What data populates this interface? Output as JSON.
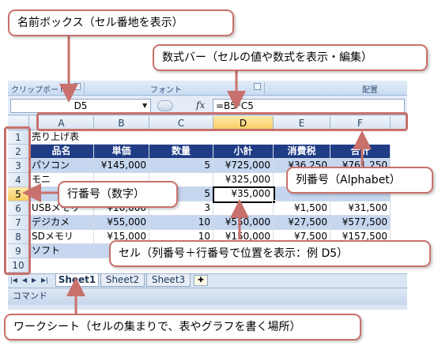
{
  "callouts": {
    "namebox": "名前ボックス（セル番地を表示）",
    "formulabar": "数式バー（セルの値や数式を表示・編集）",
    "column_number": "列番号（Alphabet）",
    "row_number": "行番号（数字）",
    "cell": "セル（列番号＋行番号で位置を表示：例 D5）",
    "worksheet": "ワークシート（セルの集まりで、表やグラフを書く場所）"
  },
  "ribbon": {
    "groups": [
      "クリップボード",
      "フォント",
      "配置"
    ]
  },
  "formula_bar": {
    "namebox_value": "D5",
    "fx_label": "fx",
    "formula": "=B5*C5"
  },
  "grid": {
    "columns": [
      "A",
      "B",
      "C",
      "D",
      "E",
      "F"
    ],
    "rows": [
      "1",
      "2",
      "3",
      "4",
      "5",
      "6",
      "7",
      "8",
      "9",
      "10"
    ],
    "selected_column": "D",
    "selected_row": "5",
    "title": "売り上げ表",
    "headers": [
      "品名",
      "単価",
      "数量",
      "小計",
      "消費税",
      "合計"
    ],
    "data": [
      [
        "パソコン",
        "¥145,000",
        "5",
        "¥725,000",
        "¥36,250",
        "¥761,250"
      ],
      [
        "モニ",
        "",
        "",
        "¥325,000",
        "",
        ""
      ],
      [
        "",
        "",
        "5",
        "¥35,000",
        "",
        ""
      ],
      [
        "USBメモリ",
        "¥10,000",
        "3",
        "",
        "¥1,500",
        "¥31,500"
      ],
      [
        "デジカメ",
        "¥55,000",
        "10",
        "¥550,000",
        "¥27,500",
        "¥577,500"
      ],
      [
        "SDメモリ",
        "¥15,000",
        "10",
        "¥150,000",
        "¥7,500",
        "¥157,500"
      ],
      [
        "ソフト",
        "¥",
        "",
        "",
        "",
        ""
      ]
    ],
    "active_cell_value": "¥35,000"
  },
  "sheet_tabs": [
    "Sheet1",
    "Sheet2",
    "Sheet3"
  ],
  "status_bar": "コマンド",
  "colors": {
    "callout_border": "#c8706b",
    "table_header": "#1f3c85",
    "band_row": "#c6d6ef"
  }
}
